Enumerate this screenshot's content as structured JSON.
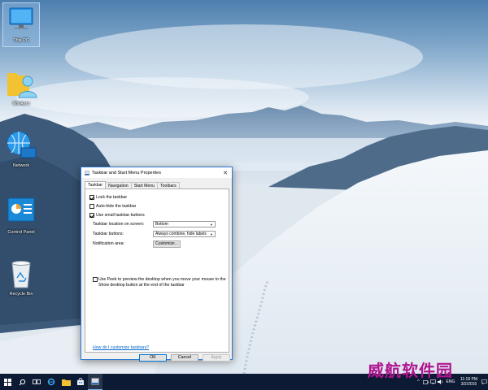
{
  "desktop": {
    "icons": [
      {
        "label": "This PC",
        "icon": "this-pc-icon"
      },
      {
        "label": "WinAero",
        "icon": "user-folder-icon"
      },
      {
        "label": "Network",
        "icon": "network-icon"
      },
      {
        "label": "Control Panel",
        "icon": "control-panel-icon"
      },
      {
        "label": "Recycle Bin",
        "icon": "recycle-bin-icon"
      }
    ]
  },
  "dialog": {
    "title": "Taskbar and Start Menu Properties",
    "tabs": [
      "Taskbar",
      "Navigation",
      "Start Menu",
      "Toolbars"
    ],
    "active_tab": "Taskbar",
    "checkboxes": {
      "lock": {
        "label": "Lock the taskbar",
        "checked": true
      },
      "autohide": {
        "label": "Auto-hide the taskbar",
        "checked": false
      },
      "small_buttons": {
        "label": "Use small taskbar buttons",
        "checked": true
      }
    },
    "location": {
      "label": "Taskbar location on screen:",
      "value": "Bottom"
    },
    "buttons_setting": {
      "label": "Taskbar buttons:",
      "value": "Always combine, hide labels"
    },
    "notification": {
      "label": "Notification area:",
      "button": "Customize..."
    },
    "peek": {
      "label": "Use Peek to preview the desktop when you move your mouse to the Show desktop button at the end of the taskbar",
      "checked": false
    },
    "help_link": "How do I customize taskbars?",
    "ok": "OK",
    "cancel": "Cancel",
    "apply": "Apply"
  },
  "taskbar": {
    "tray": {
      "language": "ENG",
      "time": "11:18 PM",
      "date": "3/2/2015"
    }
  },
  "watermark": "威航软件园",
  "colors": {
    "accent": "#0078d7",
    "taskbar": "#0c1a33",
    "link": "#0066cc"
  }
}
